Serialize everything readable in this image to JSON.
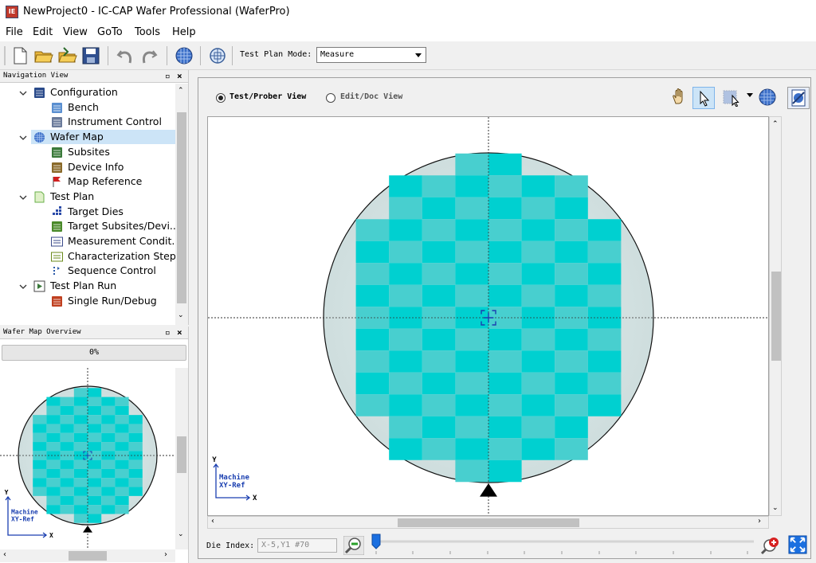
{
  "window": {
    "title": "NewProject0 - IC-CAP Wafer Professional (WaferPro)",
    "icon_text": "IE"
  },
  "menu": [
    "File",
    "Edit",
    "View",
    "GoTo",
    "Tools",
    "Help"
  ],
  "toolbar": {
    "test_plan_mode_label": "Test Plan Mode:",
    "test_plan_mode_value": "Measure"
  },
  "nav_view": {
    "title": "Navigation View",
    "items": [
      {
        "label": "Configuration",
        "icon": "configuration-icon",
        "level": 0
      },
      {
        "label": "Bench",
        "icon": "bench-icon",
        "level": 1
      },
      {
        "label": "Instrument Control",
        "icon": "instrument-icon",
        "level": 1
      },
      {
        "label": "Wafer Map",
        "icon": "wafer-icon",
        "level": 0,
        "selected": true
      },
      {
        "label": "Subsites",
        "icon": "subsites-icon",
        "level": 1
      },
      {
        "label": "Device Info",
        "icon": "device-info-icon",
        "level": 1
      },
      {
        "label": "Map Reference",
        "icon": "flag-icon",
        "level": 1
      },
      {
        "label": "Test Plan",
        "icon": "test-plan-icon",
        "level": 0
      },
      {
        "label": "Target Dies",
        "icon": "target-dies-icon",
        "level": 1
      },
      {
        "label": "Target Subsites/Devi...",
        "icon": "target-subsites-icon",
        "level": 1
      },
      {
        "label": "Measurement Condit...",
        "icon": "mc-icon",
        "level": 1
      },
      {
        "label": "Characterization Steps",
        "icon": "cs-icon",
        "level": 1
      },
      {
        "label": "Sequence Control",
        "icon": "sequence-icon",
        "level": 1
      },
      {
        "label": "Test Plan Run",
        "icon": "run-icon",
        "level": 0
      },
      {
        "label": "Single Run/Debug",
        "icon": "debug-icon",
        "level": 1
      }
    ]
  },
  "overview": {
    "title": "Wafer Map Overview",
    "progress": "0%",
    "progress_value": 0
  },
  "view_mode": {
    "test_prober": "Test/Prober View",
    "edit_doc": "Edit/Doc View",
    "selected": "test_prober"
  },
  "axes_legend": {
    "y": "Y",
    "x": "X",
    "line1": "Machine",
    "line2": "XY-Ref"
  },
  "die_index": {
    "label": "Die Index:",
    "value": "X-5,Y1 #70"
  },
  "colors": {
    "die_a": "#00d0d0",
    "die_b": "#48cfcf",
    "wafer_fill": "#ccdcdc",
    "accent_blue": "#1a3fb0"
  },
  "wafer_rows": [
    [
      3,
      4
    ],
    [
      1,
      6
    ],
    [
      1,
      6
    ],
    [
      0,
      7
    ],
    [
      0,
      7
    ],
    [
      0,
      7
    ],
    [
      0,
      7
    ],
    [
      0,
      7
    ],
    [
      0,
      7
    ],
    [
      0,
      7
    ],
    [
      0,
      7
    ],
    [
      0,
      7
    ],
    [
      1,
      6
    ],
    [
      1,
      6
    ],
    [
      3,
      4
    ]
  ]
}
